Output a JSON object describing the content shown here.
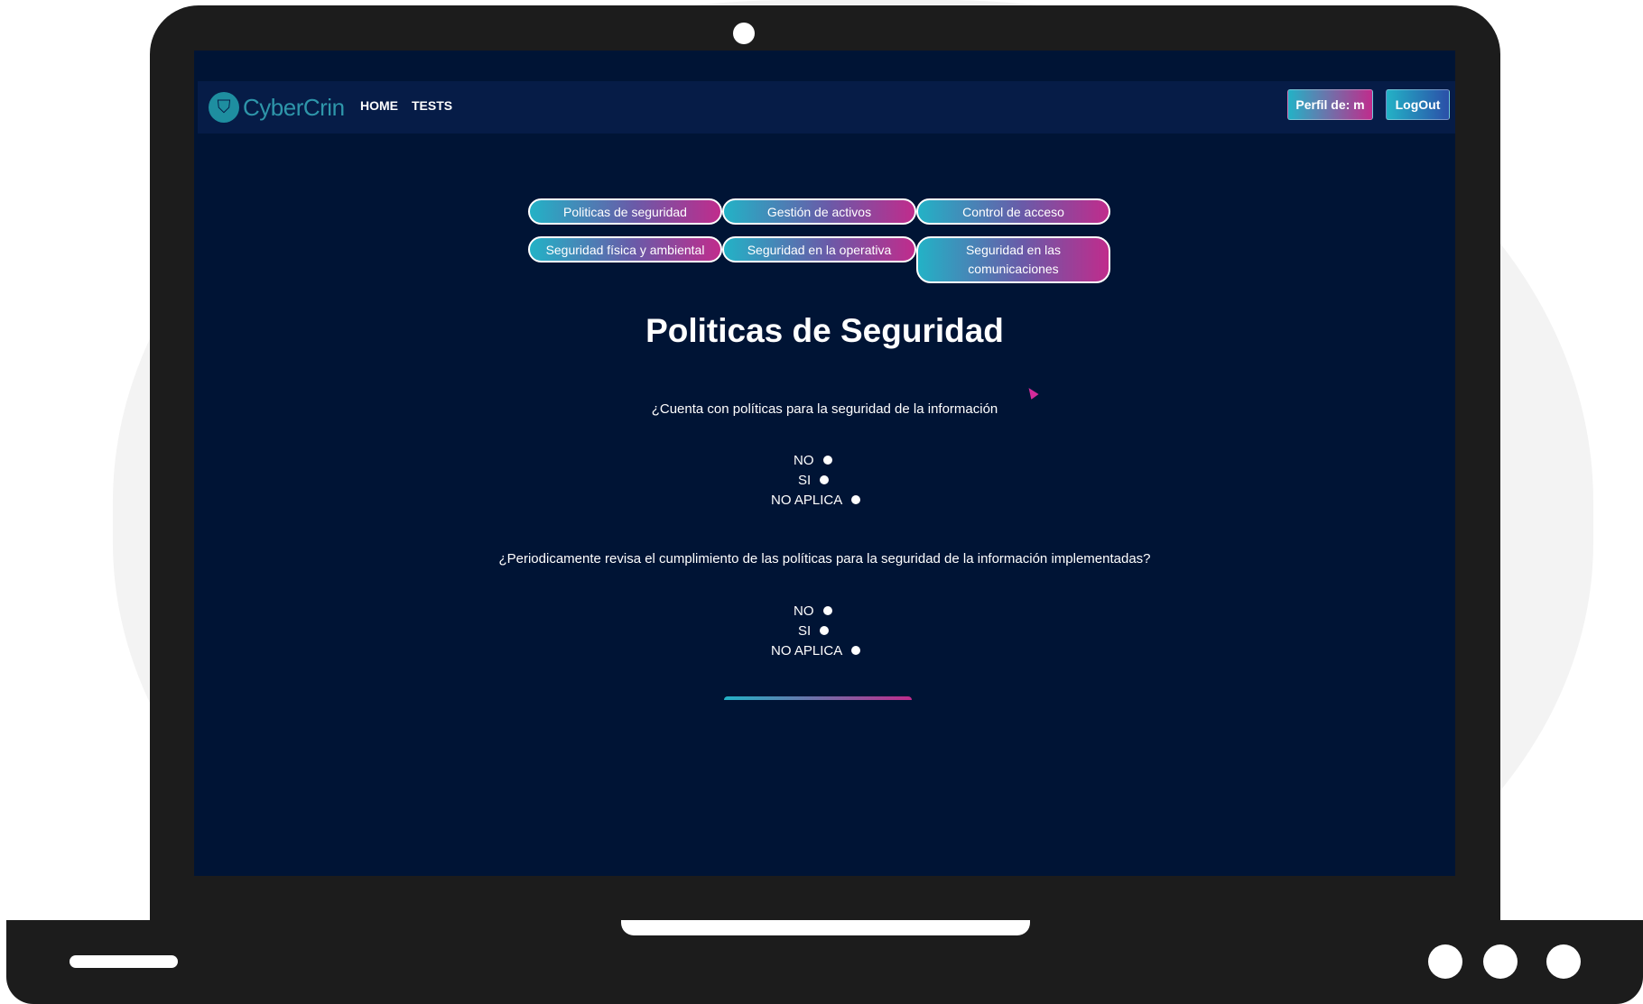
{
  "app": {
    "name": "CyberCrin"
  },
  "nav": {
    "links": [
      "HOME",
      "TESTS"
    ],
    "profile_label": "Perfil de: m",
    "logout_label": "LogOut"
  },
  "tabs": [
    "Politicas de seguridad",
    "Gestión de activos",
    "Control de acceso",
    "Seguridad física y ambiental",
    "Seguridad en la operativa",
    "Seguridad en las comunicaciones"
  ],
  "page": {
    "title": "Politicas de Seguridad"
  },
  "questions": [
    {
      "text": "¿Cuenta con políticas para la seguridad de la información",
      "options": [
        "NO",
        "SI",
        "NO APLICA"
      ]
    },
    {
      "text": "¿Periodicamente revisa el cumplimiento de las políticas para la seguridad de la información implementadas?",
      "options": [
        "NO",
        "SI",
        "NO APLICA"
      ]
    }
  ],
  "colors": {
    "background": "#001435",
    "navbar": "#061c47",
    "accent_cyan": "#23b2c6",
    "accent_magenta": "#c02c8c",
    "logo": "#2e96aa"
  },
  "icons": [
    "logo-shield-icon",
    "radio-dot-icon",
    "mouse-cursor-icon"
  ]
}
